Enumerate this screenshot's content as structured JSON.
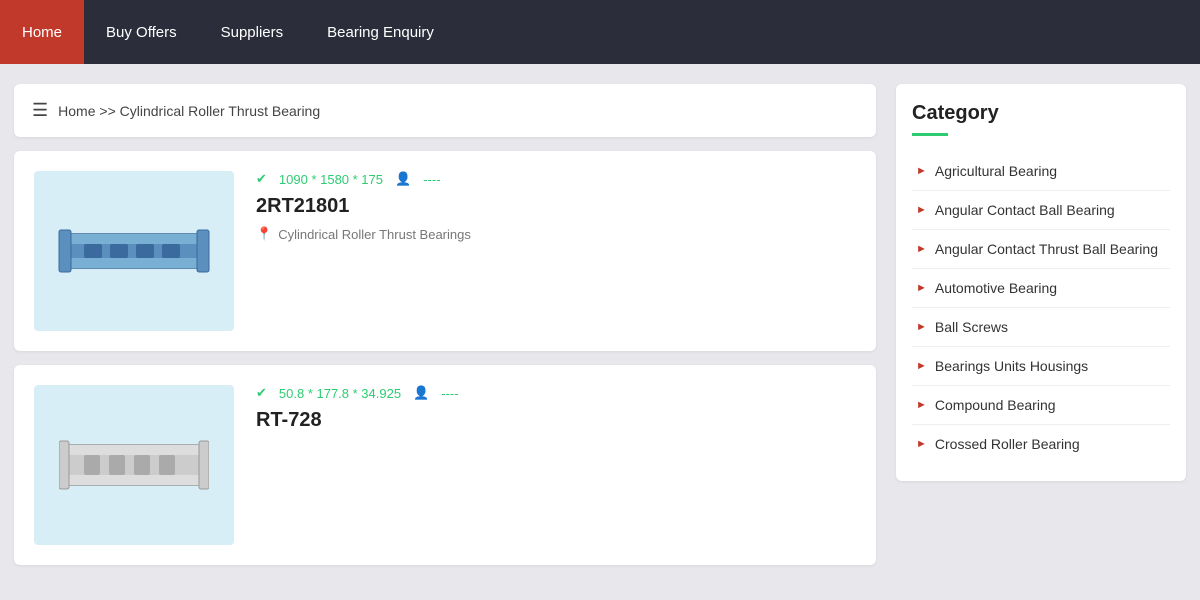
{
  "nav": {
    "items": [
      {
        "label": "Home",
        "active": true
      },
      {
        "label": "Buy Offers",
        "active": false
      },
      {
        "label": "Suppliers",
        "active": false
      },
      {
        "label": "Bearing Enquiry",
        "active": false
      }
    ]
  },
  "breadcrumb": {
    "home": "Home",
    "separator": ">>",
    "current": "Cylindrical Roller Thrust Bearing"
  },
  "products": [
    {
      "dimensions": "1090 * 1580 * 175",
      "users": "----",
      "name": "2RT21801",
      "category": "Cylindrical Roller Thrust Bearings"
    },
    {
      "dimensions": "50.8 * 177.8 * 34.925",
      "users": "----",
      "name": "RT-728",
      "category": ""
    }
  ],
  "sidebar": {
    "category_title": "Category",
    "items": [
      {
        "label": "Agricultural Bearing"
      },
      {
        "label": "Angular Contact Ball Bearing"
      },
      {
        "label": "Angular Contact Thrust Ball Bearing"
      },
      {
        "label": "Automotive Bearing"
      },
      {
        "label": "Ball Screws"
      },
      {
        "label": "Bearings Units Housings"
      },
      {
        "label": "Compound Bearing"
      },
      {
        "label": "Crossed Roller Bearing"
      }
    ]
  }
}
